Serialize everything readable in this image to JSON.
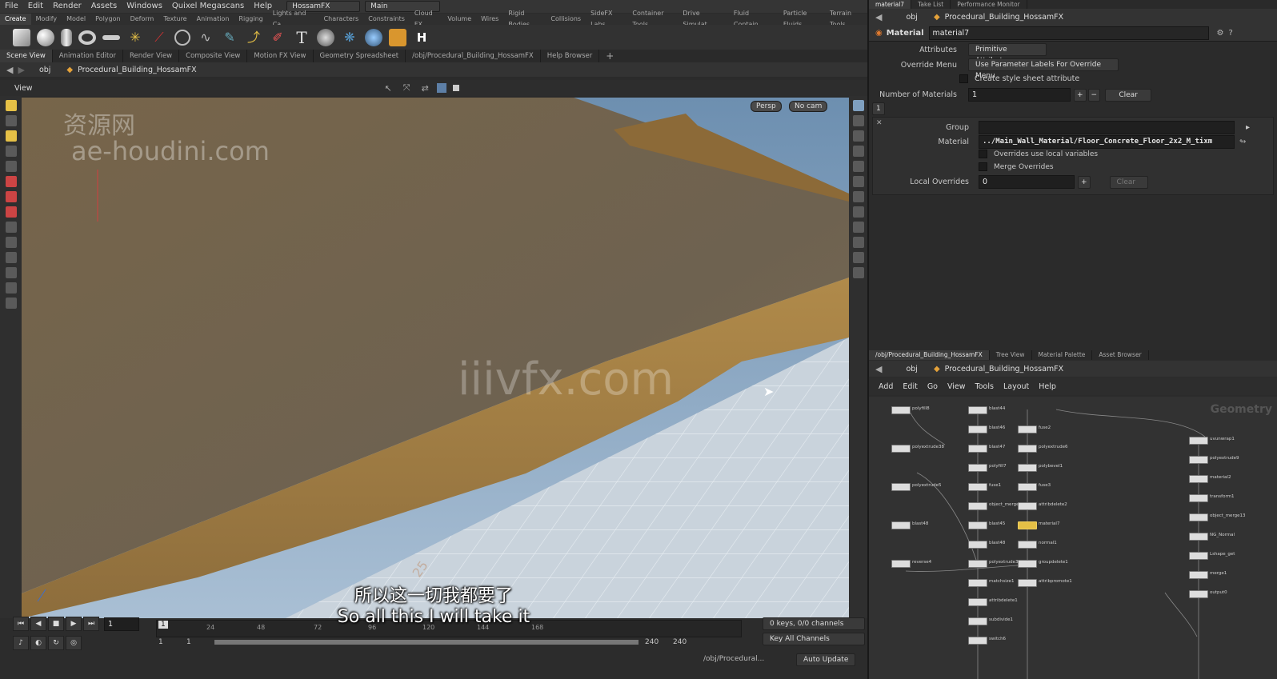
{
  "menu": {
    "items": [
      "File",
      "Edit",
      "Render",
      "Assets",
      "Windows",
      "Quixel Megascans",
      "Help"
    ],
    "desktop_label": "HossamFX",
    "context_label": "Main"
  },
  "shelf_tabs": [
    "Create",
    "Modify",
    "Model",
    "Polygon",
    "Deform",
    "Texture",
    "Animation",
    "Rigging",
    "Lights and Ca...",
    "Characters",
    "Constraints",
    "Cloud FX",
    "Volume",
    "Wires",
    "Rigid Bodies",
    "Collisions",
    "SideFX Labs",
    "Container Tools",
    "Drive Simulat...",
    "Fluid Contain...",
    "Particle Fluids",
    "Terrain Tools"
  ],
  "pane_tabs": [
    "Scene View",
    "Animation Editor",
    "Render View",
    "Composite View",
    "Motion FX View",
    "Geometry Spreadsheet",
    "/obj/Procedural_Building_HossamFX",
    "Help Browser"
  ],
  "path": {
    "root": "obj",
    "node": "Procedural_Building_HossamFX"
  },
  "viewport": {
    "title": "View",
    "camera_mode": "Persp",
    "camera": "No cam",
    "grid_label": "25"
  },
  "watermarks": {
    "cn": "资源网",
    "site": "ae-houdini.com",
    "center": "iiivfx.com"
  },
  "subtitles": {
    "cn": "所以这一切我都要了",
    "en": "So all this I will take it"
  },
  "timeline": {
    "current_frame": "1",
    "frame_marker": "1",
    "ticks": [
      "24",
      "48",
      "72",
      "96",
      "120",
      "144",
      "168"
    ],
    "start": "1",
    "start2": "1",
    "end": "240",
    "end2": "240",
    "keys_channels": "0 keys, 0/0 channels",
    "key_all_channels": "Key All Channels",
    "obj_path": "/obj/Procedural...",
    "auto_update": "Auto Update"
  },
  "right_top_tabs": [
    "material7",
    "Take List",
    "Performance Monitor"
  ],
  "param": {
    "path_root": "obj",
    "path_node": "Procedural_Building_HossamFX",
    "node_type": "Material",
    "node_name": "material7",
    "attributes_label": "Attributes",
    "attributes_value": "Primitive Attributes",
    "override_menu_label": "Override Menu",
    "override_menu_value": "Use Parameter Labels For Override Menu",
    "create_style_sheet": "Create style sheet attribute",
    "num_materials_label": "Number of Materials",
    "num_materials_value": "1",
    "clear": "Clear",
    "tab_index": "1",
    "group_label": "Group",
    "group_value": "",
    "material_label": "Material",
    "material_value": "../Main_Wall_Material/Floor_Concrete_Floor_2x2_M_tixm",
    "overrides_local": "Overrides use local variables",
    "merge_overrides": "Merge Overrides",
    "local_overrides_label": "Local Overrides",
    "local_overrides_value": "0",
    "clear2": "Clear"
  },
  "network_tabs": [
    "/obj/Procedural_Building_HossamFX",
    "Tree View",
    "Material Palette",
    "Asset Browser"
  ],
  "network_menu": [
    "Add",
    "Edit",
    "Go",
    "View",
    "Tools",
    "Layout",
    "Help"
  ],
  "network_label": "Geometry",
  "nodes": [
    {
      "label": "polyfill8"
    },
    {
      "label": "polyextrude38"
    },
    {
      "label": "polyextrude5"
    },
    {
      "label": "blast48"
    },
    {
      "label": "reverse4"
    },
    {
      "label": "blast44"
    },
    {
      "label": "blast46"
    },
    {
      "label": "blast47"
    },
    {
      "label": "polyfill7"
    },
    {
      "label": "fuse1"
    },
    {
      "label": "object_merge12"
    },
    {
      "label": "blast45"
    },
    {
      "label": "blast48"
    },
    {
      "label": "polyextrude36"
    },
    {
      "label": "matchsize1"
    },
    {
      "label": "attribdelete1"
    },
    {
      "label": "subdivide1"
    },
    {
      "label": "switch6"
    },
    {
      "label": "fuse2"
    },
    {
      "label": "polyextrude6"
    },
    {
      "label": "polybevel1"
    },
    {
      "label": "fuse3"
    },
    {
      "label": "attribdelete2"
    },
    {
      "label": "material7"
    },
    {
      "label": "normal1"
    },
    {
      "label": "groupdelete1"
    },
    {
      "label": "attribpromote1"
    },
    {
      "label": "uvunwrap1"
    },
    {
      "label": "polyextrude9"
    },
    {
      "label": "material2"
    },
    {
      "label": "transform1"
    },
    {
      "label": "object_merge13"
    },
    {
      "label": "NG_Normal"
    },
    {
      "label": "Lshape_get"
    },
    {
      "label": "merge1"
    },
    {
      "label": "output0"
    }
  ]
}
